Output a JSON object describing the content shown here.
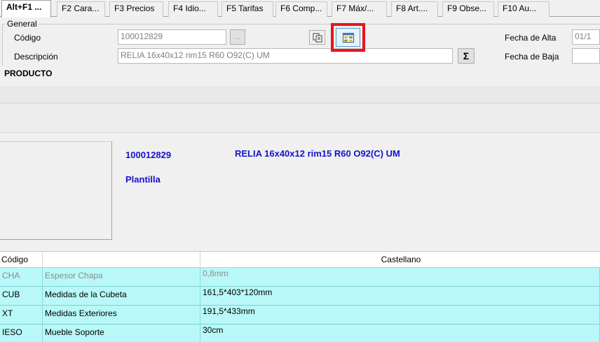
{
  "tabs": [
    {
      "label": "Alt+F1 ...",
      "active": true
    },
    {
      "label": "F2 Cara..."
    },
    {
      "label": "F3 Precios"
    },
    {
      "label": "F4 Idio..."
    },
    {
      "label": "F5 Tarifas"
    },
    {
      "label": "F6 Comp..."
    },
    {
      "label": "F7 Máx/..."
    },
    {
      "label": "F8 Art...."
    },
    {
      "label": "F9 Obse..."
    },
    {
      "label": "F10 Au..."
    }
  ],
  "general": {
    "title": "General",
    "codigo_label": "Código",
    "codigo_value": "100012829",
    "browse_label": "...",
    "descripcion_label": "Descripción",
    "descripcion_value": "RELIA 16x40x12 rim15 R60 O92(C) UM",
    "sigma_label": "Σ",
    "fecha_alta_label": "Fecha de Alta",
    "fecha_alta_value": "01/1",
    "fecha_baja_label": "Fecha de Baja",
    "fecha_baja_value": ""
  },
  "icons": {
    "copy": "copy-icon",
    "grid": "grid-view-icon"
  },
  "accent_colors": {
    "highlight": "#e8141c",
    "product_text": "#1414c8",
    "row_bg": "#b8f8f8"
  },
  "producto": {
    "title": "PRODUCTO",
    "code": "100012829",
    "description": "RELIA 16x40x12 rim15 R60 O92(C) UM",
    "subtitle": "Plantilla"
  },
  "grid": {
    "headers": [
      "Código",
      "",
      "Castellano"
    ],
    "rows": [
      {
        "code": "CHA",
        "name": "Espesor Chapa",
        "value": "0,8mm",
        "disabled": true
      },
      {
        "code": "CUB",
        "name": "Medidas de la Cubeta",
        "value": "161,5*403*120mm"
      },
      {
        "code": "XT",
        "name": "Medidas Exteriores",
        "value": "191,5*433mm"
      },
      {
        "code": "IESO",
        "name": "Mueble Soporte",
        "value": "30cm"
      }
    ]
  }
}
